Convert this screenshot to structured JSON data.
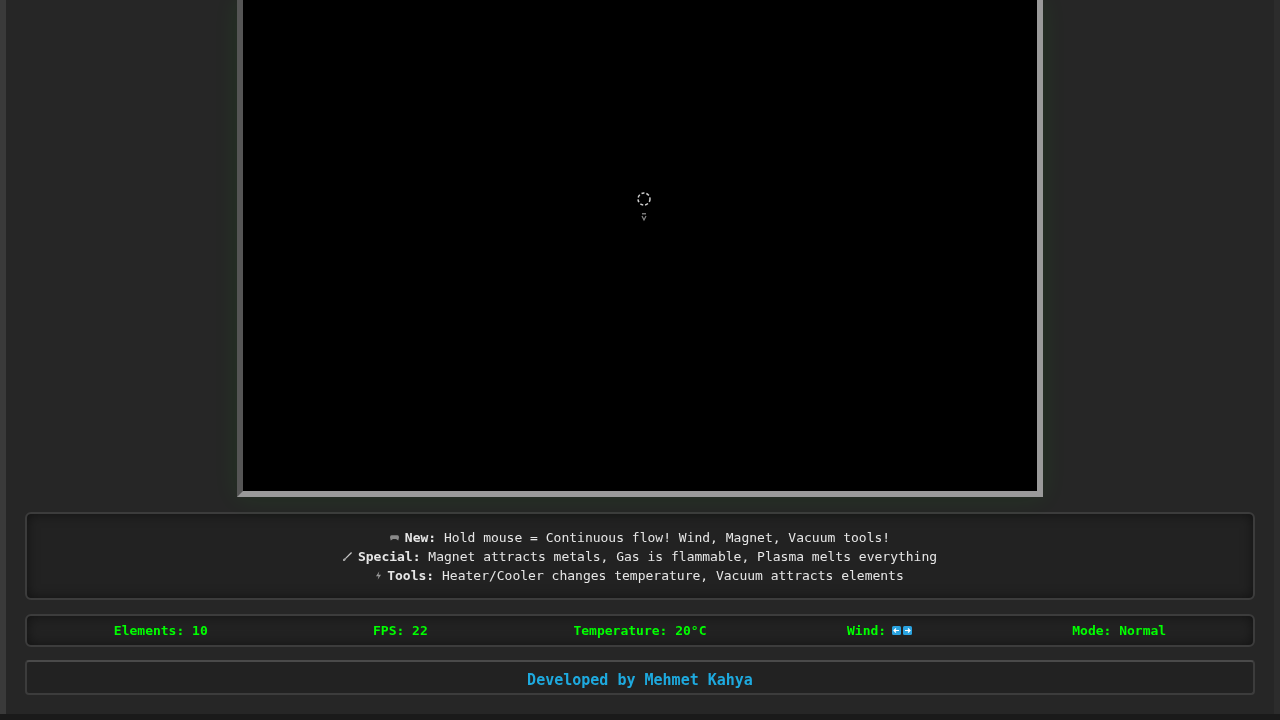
{
  "info_lines": [
    {
      "kind": "gamepad",
      "text": "**New:** Hold mouse = Continuous flow! Wind, Magnet, Vacuum tools!"
    },
    {
      "kind": "brush",
      "text": "**Special:** Magnet attracts metals, Gas is flammable, Plasma melts everything"
    },
    {
      "kind": "lightning",
      "text": "**Tools:** Heater/Cooler changes temperature, Vacuum attracts elements"
    }
  ],
  "stats": [
    {
      "kind": "text",
      "text": "Elements: 10"
    },
    {
      "kind": "text",
      "text": "FPS: 22"
    },
    {
      "kind": "text",
      "text": "Temperature: 20°C"
    },
    {
      "kind": "wind",
      "text": "Wind:"
    },
    {
      "kind": "text",
      "text": "Mode: Normal"
    }
  ],
  "footer": "Developed by Mehmet Kahya"
}
